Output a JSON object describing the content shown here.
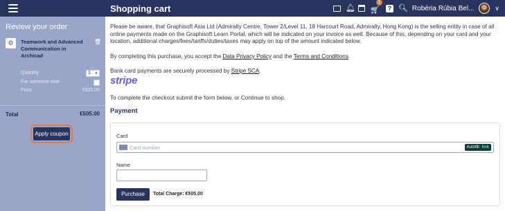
{
  "header": {
    "title": "Shopping cart",
    "cart_badge": "1",
    "user_name": "Robéria Rúbia Bel...",
    "icons": [
      "menu-icon",
      "mail-icon",
      "bell-icon",
      "calendar-icon",
      "cart-icon",
      "help-icon",
      "search-icon",
      "avatar",
      "chevron-down-icon"
    ]
  },
  "sidebar": {
    "title": "Review your order",
    "course_name": "Teamwork and Advanced Communication in Archicad",
    "quantity_label": "Quantity",
    "quantity_value": "1",
    "someone_else_label": "For someone else",
    "price_label": "Price",
    "price_value": "€505.00",
    "total_label": "Total",
    "total_value": "€505.00",
    "coupon_button": "Apply coupon"
  },
  "main": {
    "notice": "Please be aware, that Graphisoft Asia Ltd (Admiralty Centre, Tower 2/Level 11, 18 Harcourt Road, Admiralty, Hong Kong) is the selling entity in case of all online payments made on the Graphisoft Learn Portal, which will be indicated on your invoice as well. Because of this, depending on your card and your location, additional charges/fees/tariffs/duties/taxes may apply on top of the amount indicated below.",
    "terms_prefix": "By completing this purchase, you accept the",
    "privacy_link": "Data Privacy Policy",
    "terms_and": "and the",
    "terms_link": "Terms and Conditions",
    "terms_suffix": ".",
    "bank_prefix": "Bank card payments are securely processed by",
    "sca_link": "Stripe SCA",
    "bank_suffix": ".",
    "stripe_logo": "stripe",
    "checkout_hint": "To complete the checkout submit the form below, or Continue to shop.",
    "payment_heading": "Payment",
    "card_label": "Card",
    "card_placeholder": "Card number",
    "autofill_label": "Autofill",
    "autofill_link": "link",
    "name_label": "Name",
    "name_value": "",
    "purchase_button": "Purchase",
    "total_charge": "Total Charge: €505.00"
  },
  "colors": {
    "topbar": "#28345e",
    "sidebar": "#9aa6c9",
    "accent": "#e6793a",
    "stripe": "#635bff"
  }
}
